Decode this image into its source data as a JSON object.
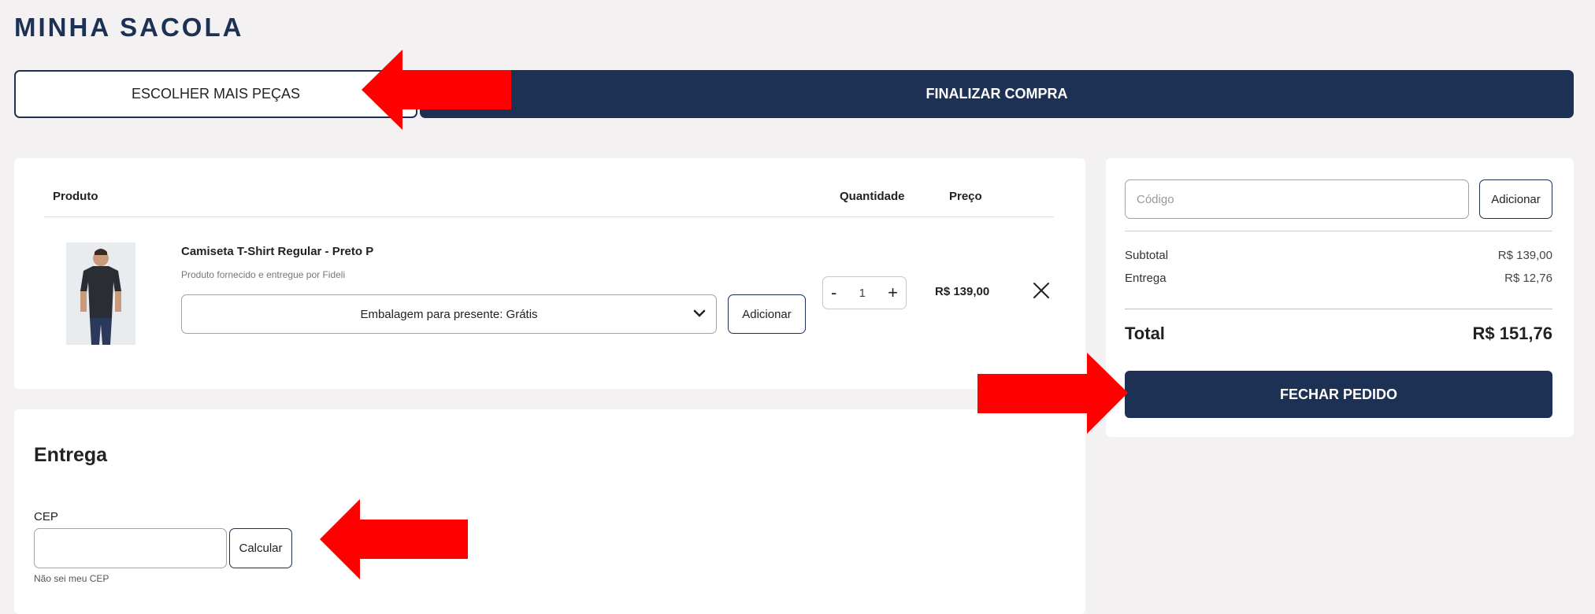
{
  "page": {
    "title": "MINHA SACOLA"
  },
  "actions": {
    "continue_shopping": "ESCOLHER MAIS PEÇAS",
    "finish_purchase": "FINALIZAR COMPRA"
  },
  "cart": {
    "headers": {
      "product": "Produto",
      "quantity": "Quantidade",
      "price": "Preço"
    },
    "item": {
      "name": "Camiseta T-Shirt Regular - Preto P",
      "seller": "Produto fornecido e entregue por Fideli",
      "gift_option": "Embalagem para presente: Grátis",
      "gift_add_label": "Adicionar",
      "quantity": "1",
      "qty_minus": "-",
      "qty_plus": "+",
      "price": "R$ 139,00"
    }
  },
  "summary": {
    "coupon_placeholder": "Código",
    "coupon_add_label": "Adicionar",
    "subtotal_label": "Subtotal",
    "subtotal_value": "R$ 139,00",
    "shipping_label": "Entrega",
    "shipping_value": "R$ 12,76",
    "total_label": "Total",
    "total_value": "R$ 151,76",
    "checkout_label": "FECHAR PEDIDO"
  },
  "delivery": {
    "title": "Entrega",
    "cep_label": "CEP",
    "calc_label": "Calcular",
    "unknown_cep_link": "Não sei meu CEP"
  },
  "colors": {
    "navy": "#1d3155",
    "arrow_red": "#ff0000",
    "background": "#f3f1f2"
  },
  "icons": [
    "chevron-down-icon",
    "close-icon",
    "red-arrow-annotation"
  ]
}
